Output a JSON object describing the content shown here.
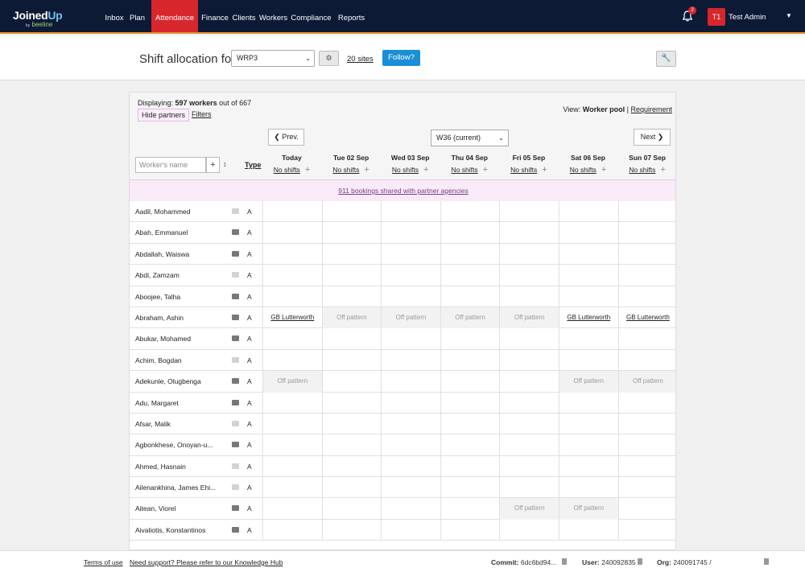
{
  "nav": {
    "logo_main": "Joined",
    "logo_up": "Up",
    "logo_by": "by",
    "logo_sub": "beeline",
    "items": [
      {
        "label": "Inbox"
      },
      {
        "label": "Plan"
      },
      {
        "label": "Attendance"
      },
      {
        "label": "Finance"
      },
      {
        "label": "Clients"
      },
      {
        "label": "Workers"
      },
      {
        "label": "Compliance"
      },
      {
        "label": "Reports"
      }
    ],
    "notifications": "2",
    "avatar": "T1",
    "user_name": "Test Admin"
  },
  "header": {
    "title": "Shift allocation for",
    "site": "WRP3",
    "sites_link": "20 sites",
    "follow": "Follow?"
  },
  "panel": {
    "displaying_label": "Displaying:",
    "displaying_count": "597 workers",
    "displaying_rest": "out of 667",
    "hide_partners": "Hide partners",
    "filters": "Filters",
    "view_label": "View:",
    "view_pool": "Worker pool",
    "view_sep": "|",
    "view_requirement": "Requirement",
    "prev": "Prev.",
    "week": "W36 (current)",
    "next": "Next",
    "name_placeholder": "Worker's name",
    "type_header": "Type",
    "partner_banner": "911 bookings shared with partner agencies",
    "days": [
      {
        "name": "Today",
        "status": "No shifts"
      },
      {
        "name": "Tue 02 Sep",
        "status": "No shifts"
      },
      {
        "name": "Wed 03 Sep",
        "status": "No shifts"
      },
      {
        "name": "Thu 04 Sep",
        "status": "No shifts"
      },
      {
        "name": "Fri 05 Sep",
        "status": "No shifts"
      },
      {
        "name": "Sat 06 Sep",
        "status": "No shifts"
      },
      {
        "name": "Sun 07 Sep",
        "status": "No shifts"
      }
    ],
    "workers": [
      {
        "name": "Aadil, Mohammed",
        "type": "A",
        "comment": false,
        "cells": [
          "",
          "",
          "",
          "",
          "",
          "",
          ""
        ]
      },
      {
        "name": "Abah, Emmanuel",
        "type": "A",
        "comment": true,
        "cells": [
          "",
          "",
          "",
          "",
          "",
          "",
          ""
        ]
      },
      {
        "name": "Abdallah, Waiswa",
        "type": "A",
        "comment": true,
        "cells": [
          "",
          "",
          "",
          "",
          "",
          "",
          ""
        ]
      },
      {
        "name": "Abdi, Zamzam",
        "type": "A",
        "comment": false,
        "cells": [
          "",
          "",
          "",
          "",
          "",
          "",
          ""
        ]
      },
      {
        "name": "Aboojee, Talha",
        "type": "A",
        "comment": true,
        "cells": [
          "",
          "",
          "",
          "",
          "",
          "",
          ""
        ]
      },
      {
        "name": "Abraham, Ashin",
        "type": "A",
        "comment": true,
        "cells": [
          "GB Lutterworth",
          "Off pattern",
          "Off pattern",
          "Off pattern",
          "Off pattern",
          "GB Lutterworth",
          "GB Lutterworth"
        ]
      },
      {
        "name": "Abukar, Mohamed",
        "type": "A",
        "comment": true,
        "cells": [
          "",
          "",
          "",
          "",
          "",
          "",
          ""
        ]
      },
      {
        "name": "Achim, Bogdan",
        "type": "A",
        "comment": false,
        "cells": [
          "",
          "",
          "",
          "",
          "",
          "",
          ""
        ]
      },
      {
        "name": "Adekunle, Olugbenga",
        "type": "A",
        "comment": true,
        "cells": [
          "Off pattern",
          "",
          "",
          "",
          "",
          "Off pattern",
          "Off pattern"
        ]
      },
      {
        "name": "Adu, Margaret",
        "type": "A",
        "comment": true,
        "cells": [
          "",
          "",
          "",
          "",
          "",
          "",
          ""
        ]
      },
      {
        "name": "Afsar, Malik",
        "type": "A",
        "comment": false,
        "cells": [
          "",
          "",
          "",
          "",
          "",
          "",
          ""
        ]
      },
      {
        "name": "Agbonkhese, Onoyan-u...",
        "type": "A",
        "comment": true,
        "cells": [
          "",
          "",
          "",
          "",
          "",
          "",
          ""
        ]
      },
      {
        "name": "Ahmed, Hasnain",
        "type": "A",
        "comment": false,
        "cells": [
          "",
          "",
          "",
          "",
          "",
          "",
          ""
        ]
      },
      {
        "name": "Ailenankhina, James Ehi...",
        "type": "A",
        "comment": false,
        "cells": [
          "",
          "",
          "",
          "",
          "",
          "",
          ""
        ]
      },
      {
        "name": "Aitean, Viorel",
        "type": "A",
        "comment": true,
        "cells": [
          "",
          "",
          "",
          "",
          "Off pattern",
          "Off pattern",
          ""
        ]
      },
      {
        "name": "Aivaliotis, Konstantinos",
        "type": "A",
        "comment": true,
        "cells": [
          "",
          "",
          "",
          "",
          "",
          "",
          ""
        ]
      }
    ]
  },
  "footer": {
    "terms": "Terms of use",
    "support": "Need support? Please refer to our Knowledge Hub",
    "commit_label": "Commit:",
    "commit_value": "6dc6bd94...",
    "user_label": "User:",
    "user_value": "240092835",
    "org_label": "Org:",
    "org_value": "240091745 /"
  }
}
